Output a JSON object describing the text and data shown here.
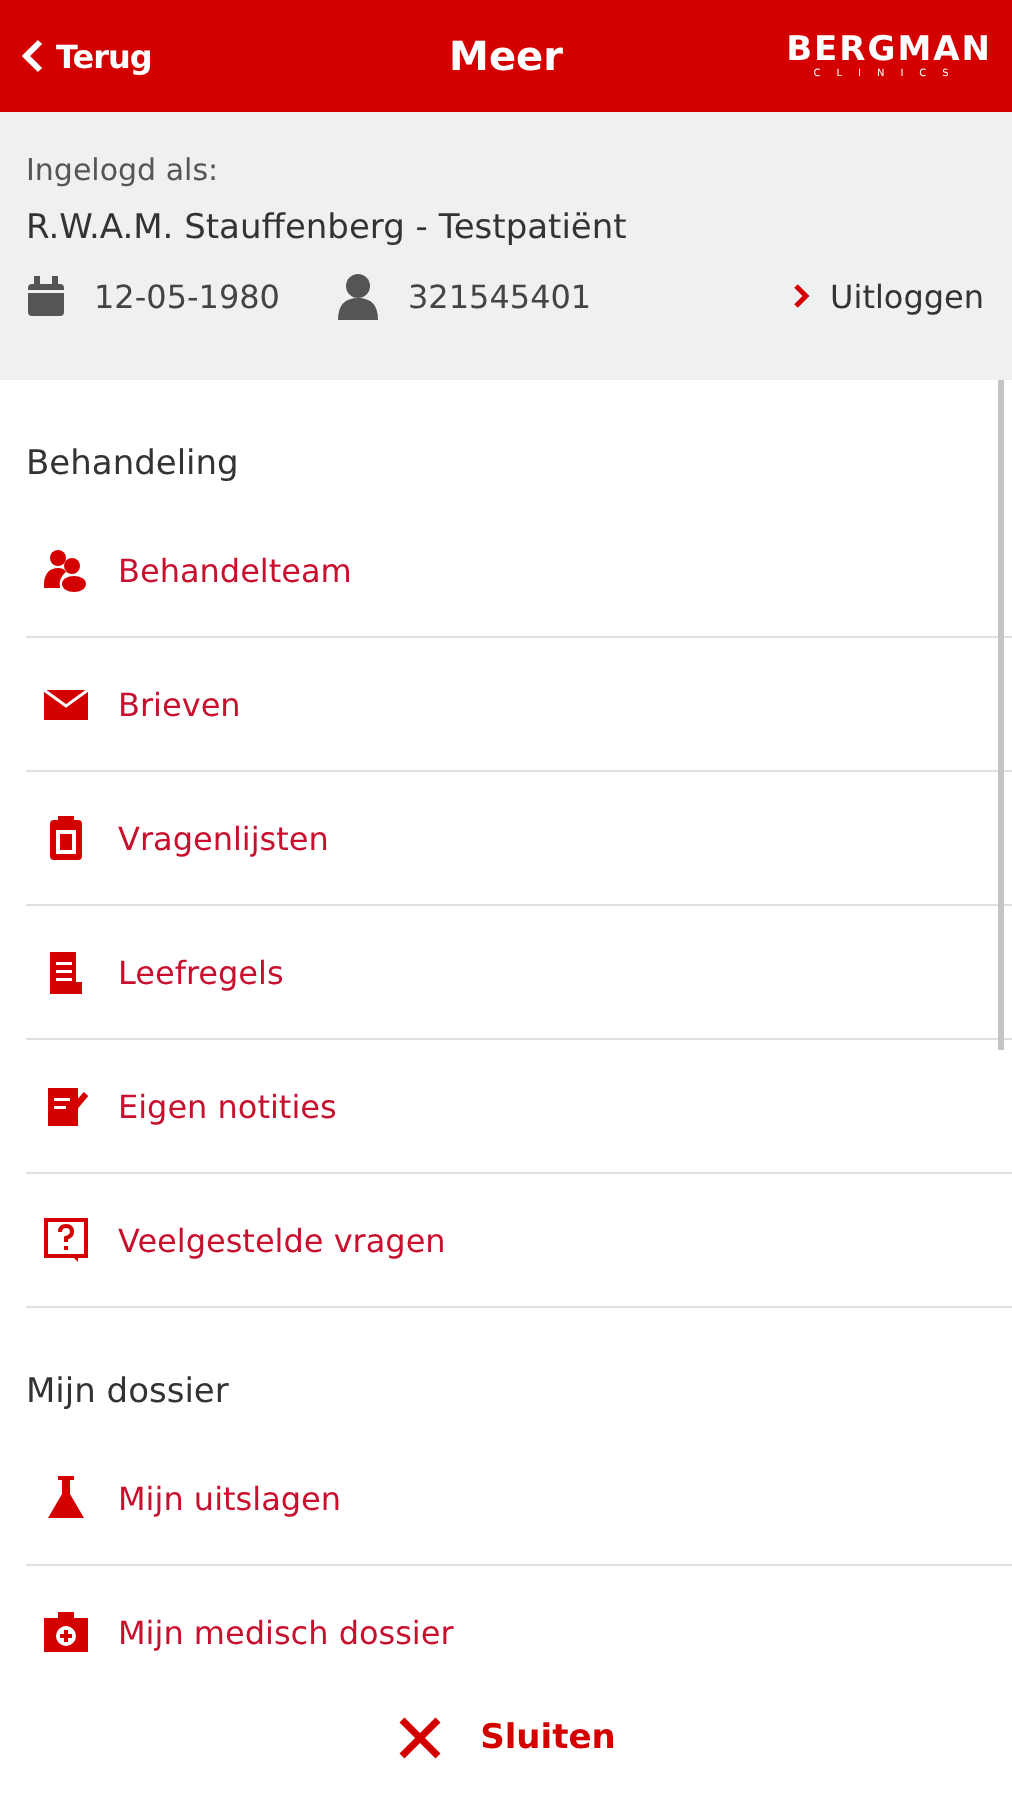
{
  "header": {
    "back": "Terug",
    "title": "Meer",
    "logo": "BERGMAN",
    "logo_sub": "CLINICS"
  },
  "account": {
    "label": "Ingelogd als:",
    "name": "R.W.A.M. Stauffenberg - Testpatiënt",
    "birthdate": "12-05-1980",
    "patient_number": "321545401",
    "logout": "Uitloggen"
  },
  "sections": [
    {
      "title": "Behandeling",
      "items": [
        {
          "label": "Behandelteam",
          "kind": "team"
        },
        {
          "label": "Brieven",
          "kind": "mail"
        },
        {
          "label": "Vragenlijsten",
          "kind": "clipboard"
        },
        {
          "label": "Leefregels",
          "kind": "scroll"
        },
        {
          "label": "Eigen notities",
          "kind": "note"
        },
        {
          "label": "Veelgestelde vragen",
          "kind": "question"
        }
      ]
    },
    {
      "title": "Mijn dossier",
      "items": [
        {
          "label": "Mijn uitslagen",
          "kind": "flask"
        },
        {
          "label": "Mijn medisch dossier",
          "kind": "medkit"
        }
      ]
    }
  ],
  "footer": {
    "close": "Sluiten"
  }
}
